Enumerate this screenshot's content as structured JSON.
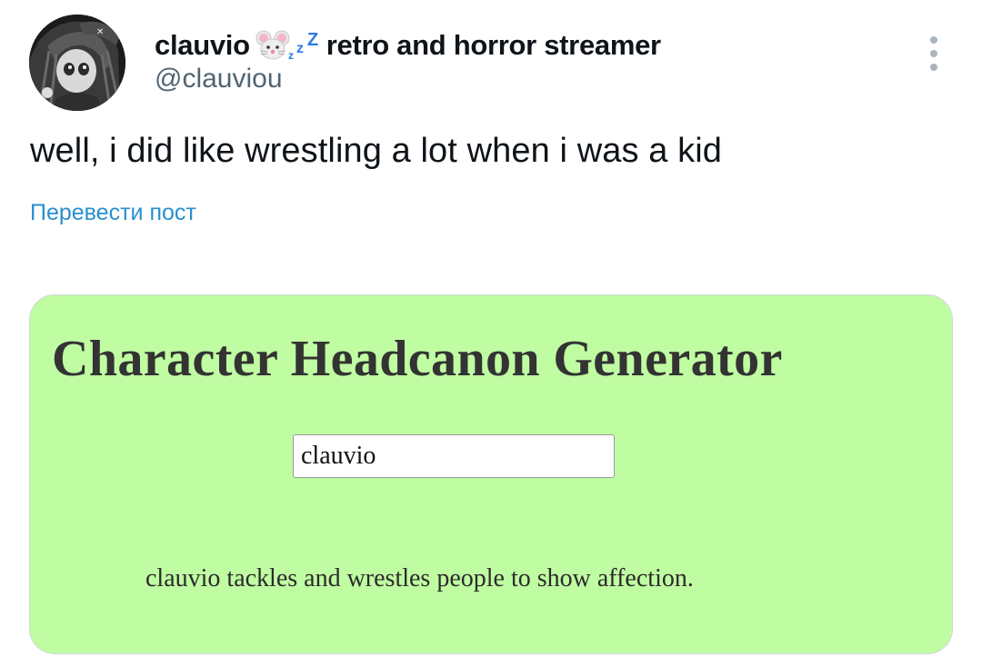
{
  "tweet": {
    "author": {
      "display_name": "clauvio",
      "name_emoji": [
        "mouse-face-icon",
        "zzz-icon"
      ],
      "name_suffix": "retro and horror streamer",
      "handle": "@clauviou"
    },
    "text": "well, i did like wrestling a lot when i was a kid",
    "translate_label": "Перевести пост",
    "colors": {
      "text": "#0f1419",
      "secondary": "#536471",
      "link": "#2a8fcf"
    }
  },
  "media": {
    "title": "Character Headcanon Generator",
    "input_value": "clauvio",
    "result": "clauvio tackles and wrestles people to show affection.",
    "colors": {
      "background": "#c0fca2",
      "title": "#333333"
    }
  }
}
